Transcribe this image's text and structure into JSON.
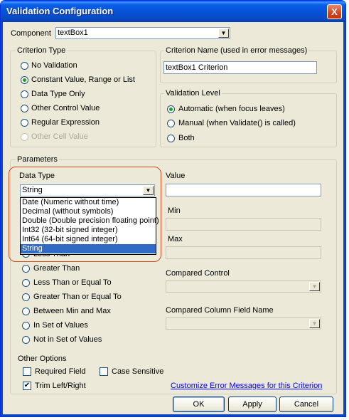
{
  "window": {
    "title": "Validation Configuration",
    "close_glyph": "X"
  },
  "component": {
    "label": "Component",
    "value": "textBox1"
  },
  "criterion_type": {
    "title": "Criterion Type",
    "options": [
      {
        "label": "No Validation",
        "selected": false,
        "enabled": true
      },
      {
        "label": "Constant Value, Range or List",
        "selected": true,
        "enabled": true
      },
      {
        "label": "Data Type Only",
        "selected": false,
        "enabled": true
      },
      {
        "label": "Other Control Value",
        "selected": false,
        "enabled": true
      },
      {
        "label": "Regular Expression",
        "selected": false,
        "enabled": true
      },
      {
        "label": "Other Cell Value",
        "selected": false,
        "enabled": false
      }
    ]
  },
  "criterion_name": {
    "title": "Criterion Name (used in error messages)",
    "value": "textBox1 Criterion"
  },
  "validation_level": {
    "title": "Validation Level",
    "options": [
      {
        "label": "Automatic (when focus leaves)",
        "selected": true
      },
      {
        "label": "Manual (when Validate() is called)",
        "selected": false
      },
      {
        "label": "Both",
        "selected": false
      }
    ]
  },
  "parameters": {
    "title": "Parameters",
    "data_type_label": "Data Type",
    "data_type_value": "String",
    "data_type_options": [
      "Date (Numeric without time)",
      "Decimal (without symbols)",
      "Double (Double precision floating point)",
      "Int32 (32-bit signed integer)",
      "Int64 (64-bit signed integer)",
      "String"
    ],
    "data_type_selected_index": 5,
    "value_label": "Value",
    "value": "",
    "min_label": "Min",
    "max_label": "Max",
    "compared_control_label": "Compared Control",
    "compared_column_label": "Compared Column Field Name",
    "operator_partial_text": "Less Than",
    "operators": [
      "Greater Than",
      "Less Than or Equal To",
      "Greater Than or Equal To",
      "Between Min and Max",
      "In Set of Values",
      "Not in Set of Values"
    ],
    "other_options_label": "Other Options",
    "required_field": {
      "label": "Required Field",
      "checked": false
    },
    "case_sensitive": {
      "label": "Case Sensitive",
      "checked": false
    },
    "trim": {
      "label": "Trim Left/Right",
      "checked": true
    },
    "customize_link": "Customize Error Messages for this Criterion"
  },
  "buttons": {
    "ok": "OK",
    "apply": "Apply",
    "cancel": "Cancel"
  },
  "colors": {
    "title_bar": "#0552d6",
    "dialog_bg": "#ece9d8",
    "selection": "#316ac5",
    "annotation": "#d24c1c",
    "link": "#0000ff"
  }
}
